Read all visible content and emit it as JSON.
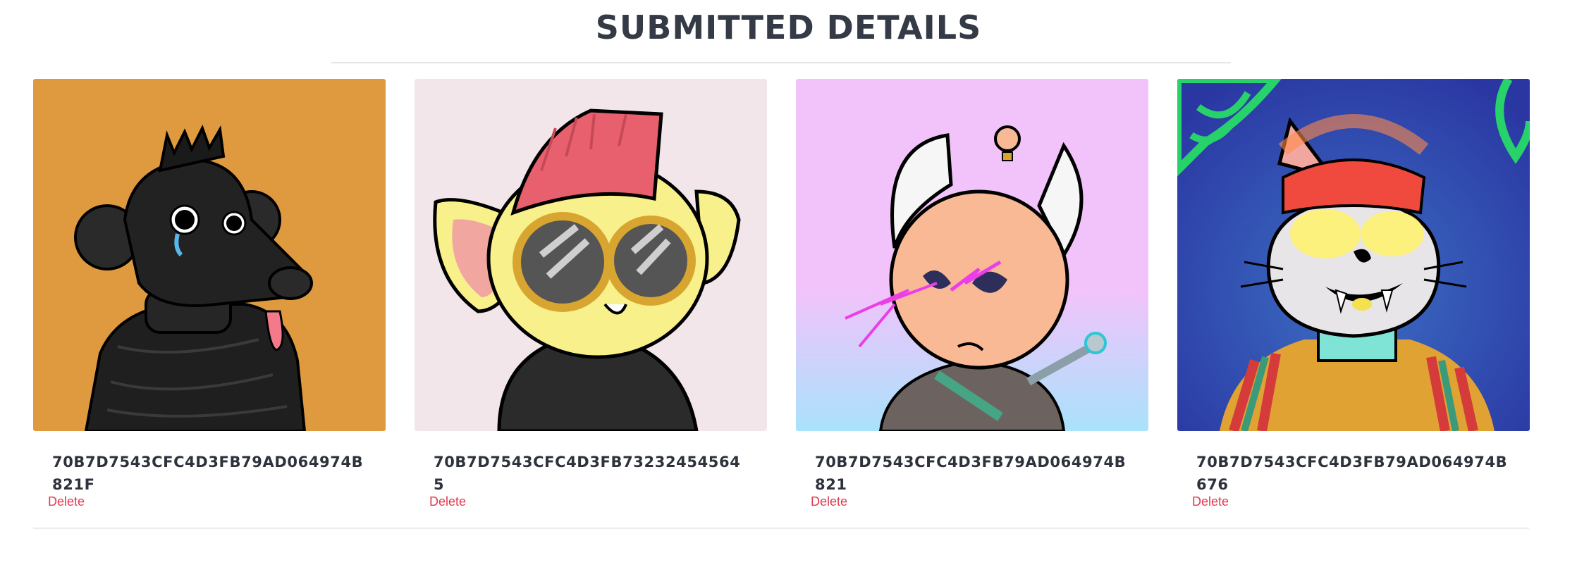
{
  "header": {
    "title": "SUBMITTED DETAILS"
  },
  "cards": [
    {
      "id_text": "70B7D7543CFC4D3FB79AD064974B821F",
      "delete_label": "Delete",
      "background_color": "#df9a40",
      "image_subject": "black rat with mohawk, tongue out, black puffer jacket"
    },
    {
      "id_text": "70B7D7543CFC4D3FB732324545645",
      "delete_label": "Delete",
      "background_color": "#f2e6ea",
      "image_subject": "yellow creature with pink mohawk and round sunglasses"
    },
    {
      "id_text": "70B7D7543CFC4D3FB79AD064974B821",
      "delete_label": "Delete",
      "background_color": "#f2c3fb",
      "image_subject": "peach round head with horns, lightning eyes, staff"
    },
    {
      "id_text": "70B7D7543CFC4D3FB79AD064974B676",
      "delete_label": "Delete",
      "background_color": "#2d3fa8",
      "image_subject": "cat with glowing head, fangs, colorful sweater"
    }
  ],
  "colors": {
    "title": "#343a46",
    "delete_link": "#e03a4f",
    "divider": "#e6e6e6"
  }
}
